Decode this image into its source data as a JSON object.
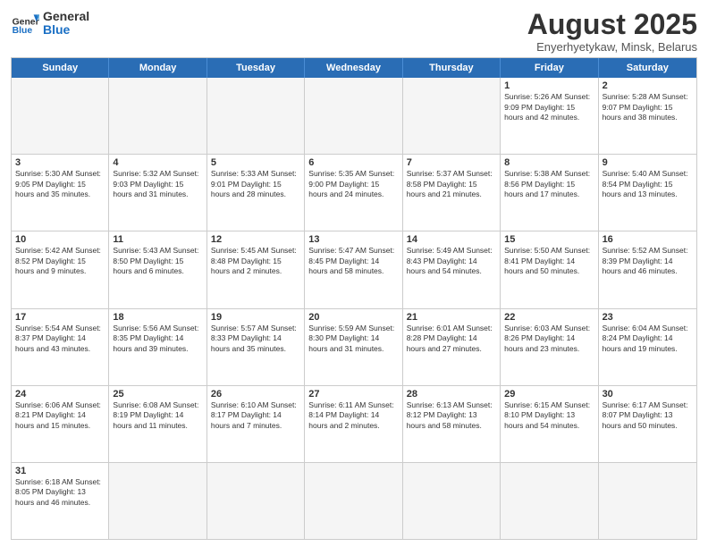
{
  "logo": {
    "general": "General",
    "blue": "Blue"
  },
  "title": "August 2025",
  "subtitle": "Enyerhyetykaw, Minsk, Belarus",
  "headers": [
    "Sunday",
    "Monday",
    "Tuesday",
    "Wednesday",
    "Thursday",
    "Friday",
    "Saturday"
  ],
  "weeks": [
    [
      {
        "day": "",
        "info": "",
        "empty": true
      },
      {
        "day": "",
        "info": "",
        "empty": true
      },
      {
        "day": "",
        "info": "",
        "empty": true
      },
      {
        "day": "",
        "info": "",
        "empty": true
      },
      {
        "day": "",
        "info": "",
        "empty": true
      },
      {
        "day": "1",
        "info": "Sunrise: 5:26 AM\nSunset: 9:09 PM\nDaylight: 15 hours\nand 42 minutes."
      },
      {
        "day": "2",
        "info": "Sunrise: 5:28 AM\nSunset: 9:07 PM\nDaylight: 15 hours\nand 38 minutes."
      }
    ],
    [
      {
        "day": "3",
        "info": "Sunrise: 5:30 AM\nSunset: 9:05 PM\nDaylight: 15 hours\nand 35 minutes."
      },
      {
        "day": "4",
        "info": "Sunrise: 5:32 AM\nSunset: 9:03 PM\nDaylight: 15 hours\nand 31 minutes."
      },
      {
        "day": "5",
        "info": "Sunrise: 5:33 AM\nSunset: 9:01 PM\nDaylight: 15 hours\nand 28 minutes."
      },
      {
        "day": "6",
        "info": "Sunrise: 5:35 AM\nSunset: 9:00 PM\nDaylight: 15 hours\nand 24 minutes."
      },
      {
        "day": "7",
        "info": "Sunrise: 5:37 AM\nSunset: 8:58 PM\nDaylight: 15 hours\nand 21 minutes."
      },
      {
        "day": "8",
        "info": "Sunrise: 5:38 AM\nSunset: 8:56 PM\nDaylight: 15 hours\nand 17 minutes."
      },
      {
        "day": "9",
        "info": "Sunrise: 5:40 AM\nSunset: 8:54 PM\nDaylight: 15 hours\nand 13 minutes."
      }
    ],
    [
      {
        "day": "10",
        "info": "Sunrise: 5:42 AM\nSunset: 8:52 PM\nDaylight: 15 hours\nand 9 minutes."
      },
      {
        "day": "11",
        "info": "Sunrise: 5:43 AM\nSunset: 8:50 PM\nDaylight: 15 hours\nand 6 minutes."
      },
      {
        "day": "12",
        "info": "Sunrise: 5:45 AM\nSunset: 8:48 PM\nDaylight: 15 hours\nand 2 minutes."
      },
      {
        "day": "13",
        "info": "Sunrise: 5:47 AM\nSunset: 8:45 PM\nDaylight: 14 hours\nand 58 minutes."
      },
      {
        "day": "14",
        "info": "Sunrise: 5:49 AM\nSunset: 8:43 PM\nDaylight: 14 hours\nand 54 minutes."
      },
      {
        "day": "15",
        "info": "Sunrise: 5:50 AM\nSunset: 8:41 PM\nDaylight: 14 hours\nand 50 minutes."
      },
      {
        "day": "16",
        "info": "Sunrise: 5:52 AM\nSunset: 8:39 PM\nDaylight: 14 hours\nand 46 minutes."
      }
    ],
    [
      {
        "day": "17",
        "info": "Sunrise: 5:54 AM\nSunset: 8:37 PM\nDaylight: 14 hours\nand 43 minutes."
      },
      {
        "day": "18",
        "info": "Sunrise: 5:56 AM\nSunset: 8:35 PM\nDaylight: 14 hours\nand 39 minutes."
      },
      {
        "day": "19",
        "info": "Sunrise: 5:57 AM\nSunset: 8:33 PM\nDaylight: 14 hours\nand 35 minutes."
      },
      {
        "day": "20",
        "info": "Sunrise: 5:59 AM\nSunset: 8:30 PM\nDaylight: 14 hours\nand 31 minutes."
      },
      {
        "day": "21",
        "info": "Sunrise: 6:01 AM\nSunset: 8:28 PM\nDaylight: 14 hours\nand 27 minutes."
      },
      {
        "day": "22",
        "info": "Sunrise: 6:03 AM\nSunset: 8:26 PM\nDaylight: 14 hours\nand 23 minutes."
      },
      {
        "day": "23",
        "info": "Sunrise: 6:04 AM\nSunset: 8:24 PM\nDaylight: 14 hours\nand 19 minutes."
      }
    ],
    [
      {
        "day": "24",
        "info": "Sunrise: 6:06 AM\nSunset: 8:21 PM\nDaylight: 14 hours\nand 15 minutes."
      },
      {
        "day": "25",
        "info": "Sunrise: 6:08 AM\nSunset: 8:19 PM\nDaylight: 14 hours\nand 11 minutes."
      },
      {
        "day": "26",
        "info": "Sunrise: 6:10 AM\nSunset: 8:17 PM\nDaylight: 14 hours\nand 7 minutes."
      },
      {
        "day": "27",
        "info": "Sunrise: 6:11 AM\nSunset: 8:14 PM\nDaylight: 14 hours\nand 2 minutes."
      },
      {
        "day": "28",
        "info": "Sunrise: 6:13 AM\nSunset: 8:12 PM\nDaylight: 13 hours\nand 58 minutes."
      },
      {
        "day": "29",
        "info": "Sunrise: 6:15 AM\nSunset: 8:10 PM\nDaylight: 13 hours\nand 54 minutes."
      },
      {
        "day": "30",
        "info": "Sunrise: 6:17 AM\nSunset: 8:07 PM\nDaylight: 13 hours\nand 50 minutes."
      }
    ],
    [
      {
        "day": "31",
        "info": "Sunrise: 6:18 AM\nSunset: 8:05 PM\nDaylight: 13 hours\nand 46 minutes."
      },
      {
        "day": "",
        "info": "",
        "empty": true
      },
      {
        "day": "",
        "info": "",
        "empty": true
      },
      {
        "day": "",
        "info": "",
        "empty": true
      },
      {
        "day": "",
        "info": "",
        "empty": true
      },
      {
        "day": "",
        "info": "",
        "empty": true
      },
      {
        "day": "",
        "info": "",
        "empty": true
      }
    ]
  ]
}
